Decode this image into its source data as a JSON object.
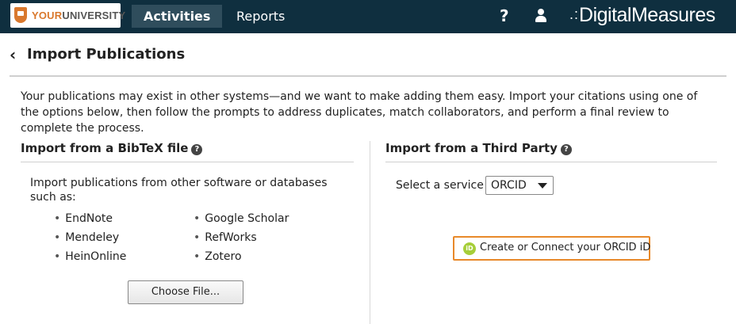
{
  "topbar": {
    "logo": {
      "prefix": "YOUR",
      "suffix": "UNIVERSITY",
      "icon": "university-shield-icon"
    },
    "tabs": [
      {
        "label": "Activities",
        "active": true
      },
      {
        "label": "Reports",
        "active": false
      }
    ],
    "help_glyph": "?",
    "user_icon": "user-icon",
    "brand": {
      "dots": ".:",
      "name": "DigitalMeasures"
    }
  },
  "page": {
    "back_glyph": "‹",
    "title": "Import Publications",
    "intro": "Your publications may exist in other systems—and we want to make adding them easy. Import your citations using one of the options below, then follow the prompts to address duplicates, match collaborators, and perform a final review to complete the process."
  },
  "bibtex": {
    "title": "Import from a BibTeX file",
    "help_glyph": "?",
    "description": "Import publications from other software or databases such as:",
    "sources": [
      "EndNote",
      "Mendeley",
      "HeinOnline",
      "Google Scholar",
      "RefWorks",
      "Zotero"
    ],
    "button_label": "Choose File..."
  },
  "third_party": {
    "title": "Import from a Third Party",
    "help_glyph": "?",
    "service_label": "Select a service",
    "service_value": "ORCID",
    "orcid_icon_text": "iD",
    "orcid_button_label": "Create or Connect your ORCID iD"
  },
  "colors": {
    "topbar": "#0f2f3f",
    "active_tab": "#2f4d5c",
    "accent_orange": "#e8892a",
    "orcid_green": "#a6ce39"
  }
}
